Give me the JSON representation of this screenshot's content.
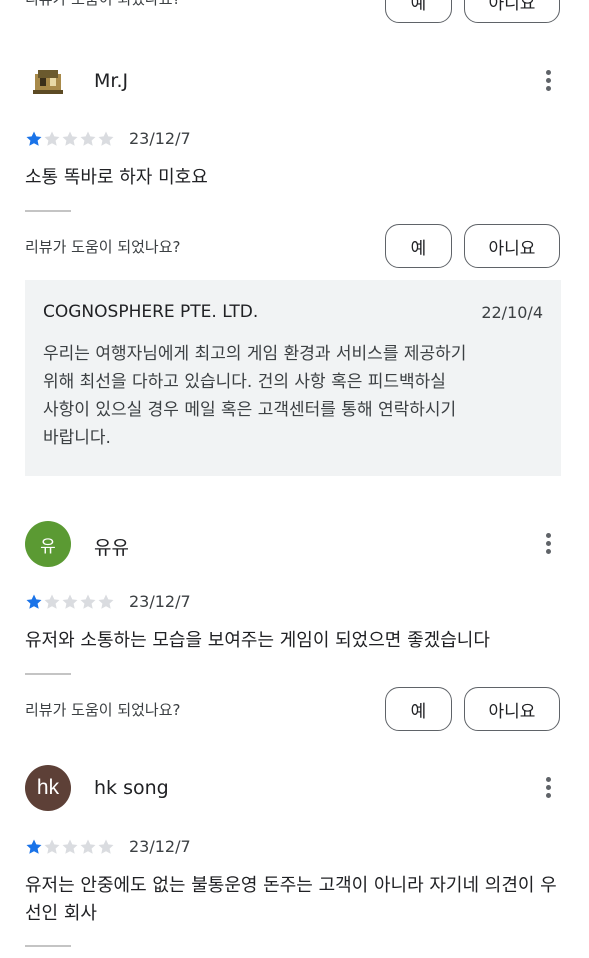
{
  "help_question": "리뷰가 도움이 되었나요?",
  "btn_yes": "예",
  "btn_no": "아니요",
  "reviews": [
    {
      "name": "Mr.J",
      "rating": 1,
      "max_rating": 5,
      "date": "23/12/7",
      "text": "소통 똑바로 하자 미호요",
      "avatar_type": "image"
    },
    {
      "name": "유유",
      "rating": 1,
      "max_rating": 5,
      "date": "23/12/7",
      "text": "유저와 소통하는 모습을 보여주는 게임이 되었으면 좋겠습니다",
      "avatar_initial": "유",
      "avatar_color": "#5b9a33"
    },
    {
      "name": "hk song",
      "rating": 1,
      "max_rating": 5,
      "date": "23/12/7",
      "text": "유저는 안중에도 없는 불통운영 돈주는 고객이 아니라 자기네 의견이 우선인 회사",
      "avatar_initial": "hk",
      "avatar_color": "#5d4037"
    }
  ],
  "developer_reply": {
    "name": "COGNOSPHERE PTE. LTD.",
    "date": "22/10/4",
    "text": "우리는 여행자님에게 최고의 게임 환경과 서비스를 제공하기\n위해 최선을 다하고 있습니다. 건의 사항 혹은 피드백하실\n사항이 있으실 경우 메일 혹은 고객센터를 통해 연락하시기\n바랍니다."
  },
  "colors": {
    "star_filled": "#1a73e8",
    "star_empty": "#dadce0",
    "reply_bg": "#f1f3f4"
  }
}
